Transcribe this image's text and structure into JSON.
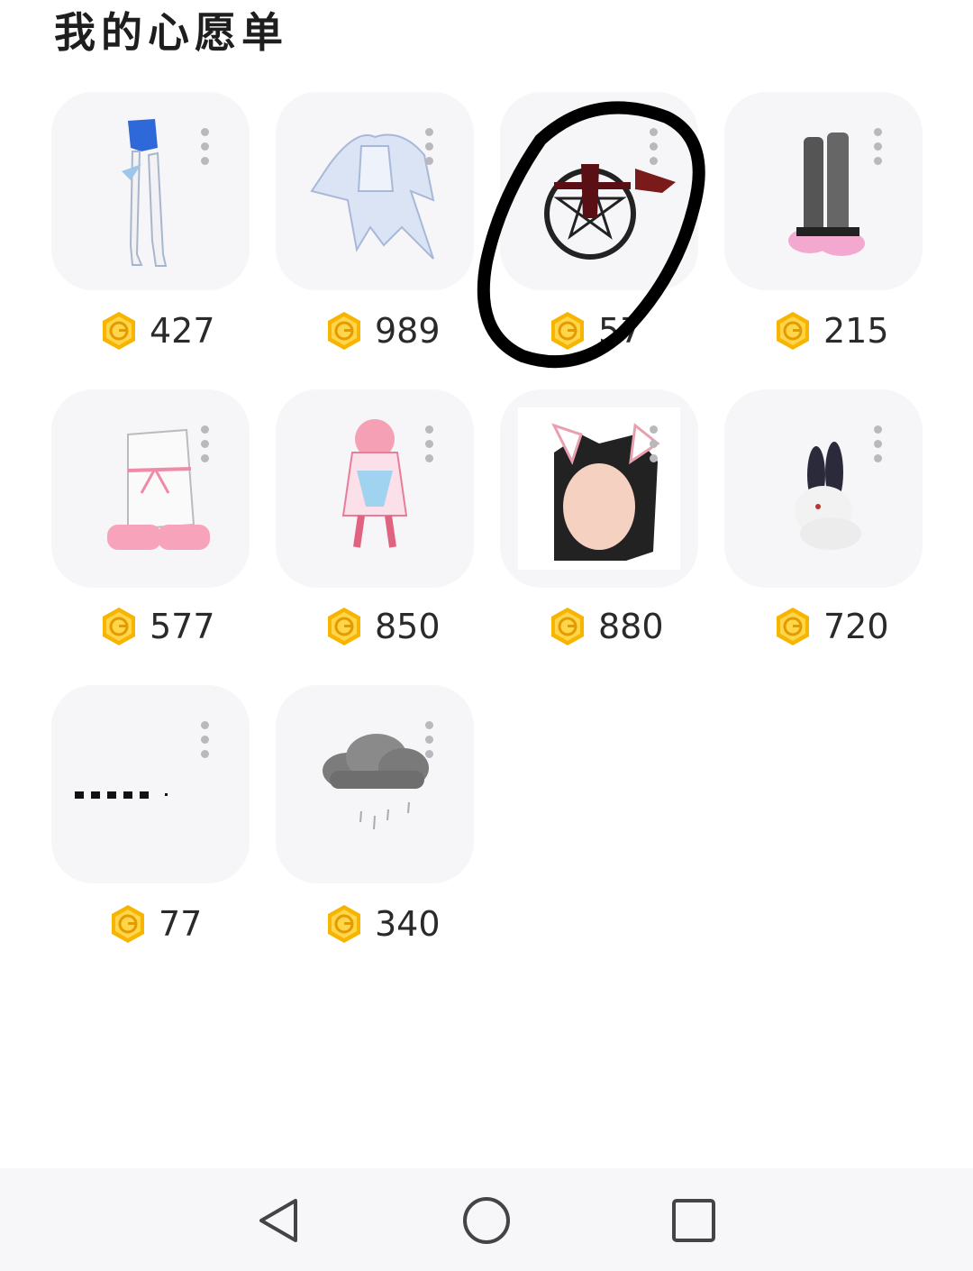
{
  "page": {
    "title": "我的心愿单"
  },
  "items": [
    {
      "name": "blue-shorts-stockings",
      "price": "427"
    },
    {
      "name": "white-frill-dress",
      "price": "989"
    },
    {
      "name": "dark-emblem-effect",
      "price": "57",
      "price_obscured_note": ""
    },
    {
      "name": "black-leg-warmers-pink-shoes",
      "price": "215"
    },
    {
      "name": "white-boots-pink-ribbon",
      "price": "577"
    },
    {
      "name": "pink-blue-costume",
      "price": "850"
    },
    {
      "name": "cat-ear-black-hair",
      "price": "880"
    },
    {
      "name": "white-rabbit-pet",
      "price": "720"
    },
    {
      "name": "dotted-trail-effect",
      "price": "77"
    },
    {
      "name": "rain-cloud-effect",
      "price": "340"
    }
  ],
  "colors": {
    "coin": "#f7b400",
    "coin_inner": "#ffd54a",
    "card_bg": "#f6f5f8",
    "annotation": "#000000"
  },
  "nav": {
    "back_icon": "triangle-back-icon",
    "home_icon": "circle-home-icon",
    "recents_icon": "square-recents-icon"
  }
}
